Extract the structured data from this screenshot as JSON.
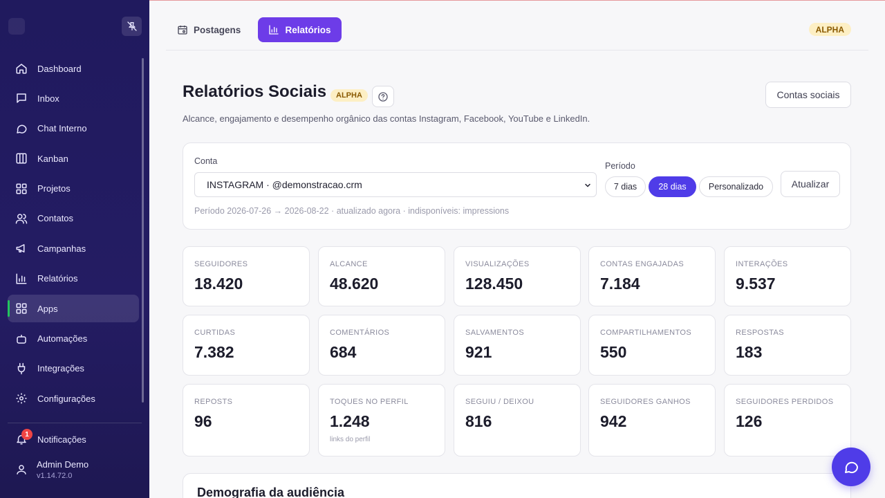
{
  "sidebar": {
    "items": [
      {
        "label": "Dashboard",
        "icon": "home-icon"
      },
      {
        "label": "Inbox",
        "icon": "inbox-icon"
      },
      {
        "label": "Chat Interno",
        "icon": "chat-icon"
      },
      {
        "label": "Kanban",
        "icon": "kanban-icon"
      },
      {
        "label": "Projetos",
        "icon": "grid-icon"
      },
      {
        "label": "Contatos",
        "icon": "users-icon"
      },
      {
        "label": "Campanhas",
        "icon": "megaphone-icon"
      },
      {
        "label": "Relatórios",
        "icon": "bar-chart-icon"
      },
      {
        "label": "Apps",
        "icon": "apps-icon"
      },
      {
        "label": "Automações",
        "icon": "bot-icon"
      },
      {
        "label": "Integrações",
        "icon": "plug-icon"
      },
      {
        "label": "Configurações",
        "icon": "gear-icon"
      }
    ],
    "active_item": "Apps",
    "notifications": {
      "label": "Notificações",
      "count": "1"
    },
    "user": {
      "name": "Admin Demo",
      "version": "v1.14.72.0"
    }
  },
  "topbar": {
    "tabs": [
      {
        "label": "Postagens",
        "active": false
      },
      {
        "label": "Relatórios",
        "active": true
      }
    ],
    "badge": "ALPHA"
  },
  "header": {
    "title": "Relatórios Sociais",
    "badge": "ALPHA",
    "subtitle": "Alcance, engajamento e desempenho orgânico das contas Instagram, Facebook, YouTube e LinkedIn.",
    "social_accounts_button": "Contas sociais"
  },
  "filters": {
    "account_label": "Conta",
    "account_value": "INSTAGRAM · @demonstracao.crm",
    "period_label": "Período",
    "period_options": [
      "7 dias",
      "28 dias",
      "Personalizado"
    ],
    "period_selected": "28 dias",
    "update_button": "Atualizar",
    "period_info": "Período 2026-07-26 → 2026-08-22 · atualizado agora · indisponíveis: impressions"
  },
  "metrics": [
    {
      "label": "SEGUIDORES",
      "value": "18.420"
    },
    {
      "label": "ALCANCE",
      "value": "48.620"
    },
    {
      "label": "VISUALIZAÇÕES",
      "value": "128.450"
    },
    {
      "label": "CONTAS ENGAJADAS",
      "value": "7.184"
    },
    {
      "label": "INTERAÇÕES",
      "value": "9.537"
    },
    {
      "label": "CURTIDAS",
      "value": "7.382"
    },
    {
      "label": "COMENTÁRIOS",
      "value": "684"
    },
    {
      "label": "SALVAMENTOS",
      "value": "921"
    },
    {
      "label": "COMPARTILHAMENTOS",
      "value": "550"
    },
    {
      "label": "RESPOSTAS",
      "value": "183"
    },
    {
      "label": "REPOSTS",
      "value": "96"
    },
    {
      "label": "TOQUES NO PERFIL",
      "value": "1.248",
      "note": "links do perfil"
    },
    {
      "label": "SEGUIU / DEIXOU",
      "value": "816"
    },
    {
      "label": "SEGUIDORES GANHOS",
      "value": "942"
    },
    {
      "label": "SEGUIDORES PERDIDOS",
      "value": "126"
    }
  ],
  "demography": {
    "title": "Demografia da audiência"
  },
  "colors": {
    "accent": "#6d3ce8",
    "accent_blue": "#4f3ce8",
    "sidebar": "#221b60",
    "alpha_bg": "#fdefc4",
    "alert": "#ef4444",
    "active_indicator": "#22c55e"
  }
}
